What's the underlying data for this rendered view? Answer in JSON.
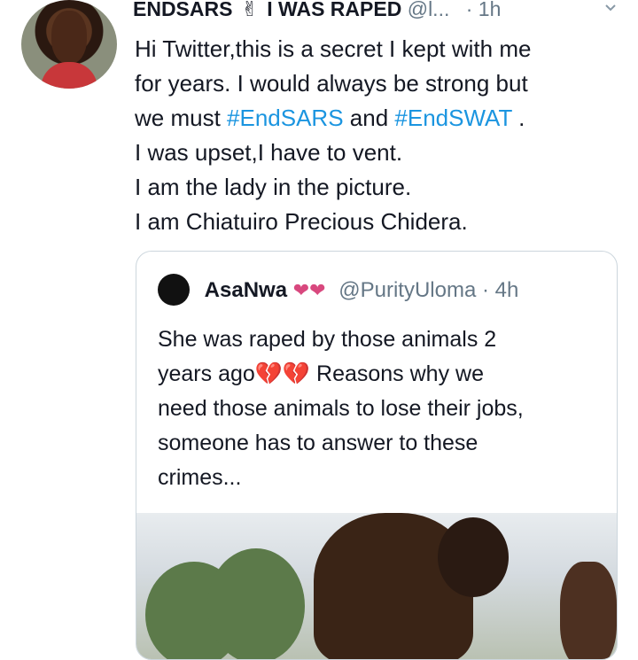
{
  "tweet": {
    "name": "ENDSARS",
    "emoji": "✌",
    "name_suffix": "I WAS RAPED",
    "handle": "@l...",
    "time": "· 1h",
    "line1": "Hi Twitter,this is a secret I kept with me",
    "line2": "for years. I would always be strong but",
    "line3_prefix": "we must ",
    "hashtag1": "#EndSARS",
    "and": " and ",
    "hashtag2": "#EndSWAT",
    "line3_end": " .",
    "line4": "I was upset,I have to vent.",
    "line5": "I am the lady in the picture.",
    "line6": "I am Chiatuiro Precious Chidera."
  },
  "quote": {
    "name": "AsaNwa",
    "hearts": "❤❤",
    "handle": "@PurityUloma",
    "time": " · 4h",
    "line1": "She was raped by those animals 2",
    "line2_prefix": "years ago",
    "broken_hearts": "💔💔",
    "line2_suffix": " Reasons why we",
    "line3": "need those animals to lose their jobs,",
    "line4": "someone has to answer to these",
    "line5": "crimes..."
  },
  "colors": {
    "hashtag": "#1b95e0",
    "muted": "#657786",
    "heart": "#d8487e"
  }
}
